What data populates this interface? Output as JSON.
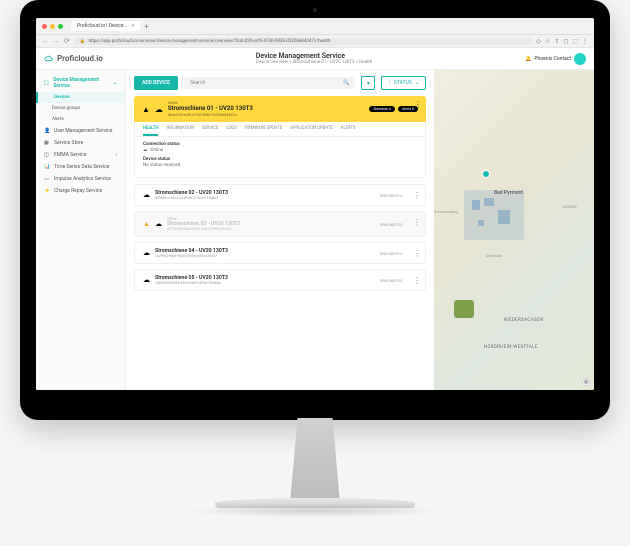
{
  "browser": {
    "tab_title": "Proficloud.io | Device...",
    "url": "https://app.proficloud.io/services/device-management-service/overview/5bdc020-ecf0-4740-9836-03228e84347c/health"
  },
  "brand": "Proficloud.io",
  "header": {
    "title": "Device Management Service",
    "breadcrumb": "Device overview > Stromschiene 01 - UV20 130T3 > Health"
  },
  "user": {
    "name": "Phoenix Contact"
  },
  "sidebar": {
    "items": [
      {
        "label": "Device Management Service",
        "active": true,
        "expandable": true
      },
      {
        "label": "User Management Service",
        "icon": "user"
      },
      {
        "label": "Service Store",
        "icon": "store"
      },
      {
        "label": "EMMA Service",
        "icon": "dashboard",
        "expandable": true
      },
      {
        "label": "Time Series Data Service",
        "icon": "chart"
      },
      {
        "label": "Impulse Analytics Service",
        "icon": "pulse"
      },
      {
        "label": "Charge Repay Service",
        "icon": "charge"
      }
    ],
    "subitems": [
      {
        "label": "Devices",
        "active": true
      },
      {
        "label": "Device groups"
      },
      {
        "label": "Alerts"
      }
    ]
  },
  "toolbar": {
    "add_label": "ADD DEVICE",
    "search_placeholder": "Search",
    "status_label": "STATUS"
  },
  "selected_device": {
    "status_label": "Online",
    "name": "Stromschiene 01 - UV20 130T3",
    "id": "5bdc020-ecf0-4740-9836-03228e84347c",
    "badges": [
      "Schedule A",
      "Alerts 0"
    ]
  },
  "tabs": [
    "HEALTH",
    "INFORMATION",
    "SERVICE",
    "LOGS",
    "FIRMWARE UPDATE",
    "APPLICATION UPDATE",
    "ALERTS"
  ],
  "health": {
    "conn_label": "Connection status",
    "conn_value": "Online",
    "device_label": "Device status",
    "device_value": "No status received"
  },
  "devices": [
    {
      "name": "Stromschiene 02 - UV20 130T3",
      "id": "0496fbcc-ce22-4449-d612-9c89718dad7",
      "meta": "EEM-SB370-C",
      "offline": false,
      "warn": false
    },
    {
      "name": "Stromschiene 03 - UV20 130T3",
      "id": "d778b5d0-0ba2-30e2-b404-69f8c82fe3a2",
      "meta": "EEM-SB370-C",
      "offline": true,
      "warn": true,
      "status": "Offline"
    },
    {
      "name": "Stromschiene 04 - UV20 130T3",
      "id": "2b29fa2-fbbd-9838-2045-c6df4cd56cb7",
      "meta": "EEM-SB370-C",
      "offline": false,
      "warn": false
    },
    {
      "name": "Stromschiene 05 - UV20 130T3",
      "id": "2383e395-b085-4934-ea85-c8f3b16346bb",
      "meta": "EEM-SB370-C",
      "offline": false,
      "warn": false
    }
  ],
  "map": {
    "city": "Bad Pyrmont",
    "region": "NIEDERSACHSEN",
    "region2": "NORDRHEIN-WESTFALE",
    "districts": [
      "Schimmenberg",
      "OESDORF"
    ],
    "street": "Südstraße"
  }
}
